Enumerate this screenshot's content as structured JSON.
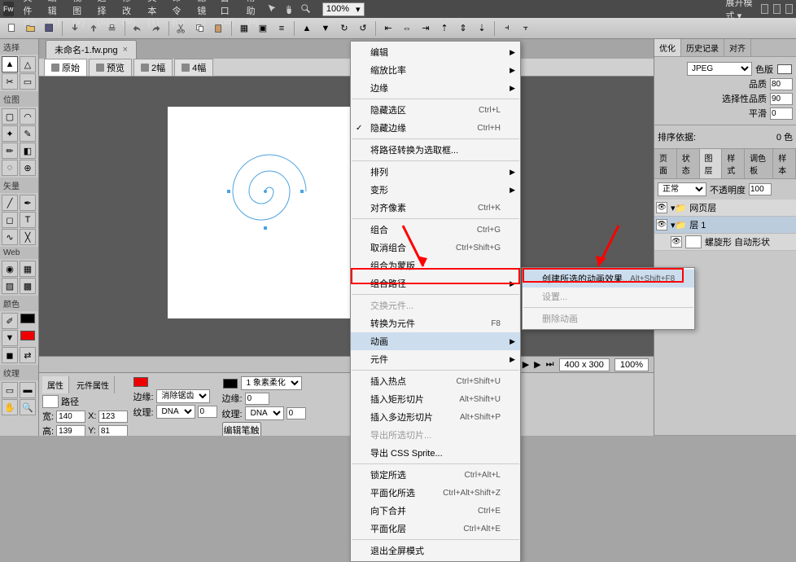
{
  "app": {
    "logo": "Fw"
  },
  "menubar": {
    "items": [
      "文件(F)",
      "编辑(E)",
      "视图(V)",
      "选择(S)",
      "修改(M)",
      "文本(T)",
      "命令(C)",
      "滤镜(I)",
      "窗口(W)",
      "帮助(H)"
    ],
    "zoom": "100%",
    "mode": "展开模式 ▾"
  },
  "left_groups": {
    "g1": "选择",
    "g2": "位图",
    "g3": "矢量",
    "g4": "Web",
    "g5": "颜色",
    "g6": "纹理"
  },
  "doc": {
    "tab": "未命名-1.fw.png",
    "viewtabs": {
      "original": "原始",
      "preview": "预览",
      "two": "2幅",
      "four": "4幅"
    }
  },
  "status": {
    "size": "400 x 300",
    "zoom": "100%"
  },
  "prop": {
    "tabs": {
      "p": "属性",
      "s": "元件属性"
    },
    "path_label": "路径",
    "stroke_label": "边缘:",
    "stroke_val": "消除锯齿",
    "fill_label": "纹理:",
    "fill_val": "DNA",
    "fill_pct": "0",
    "edge_label": "边缘:",
    "edge_val": "0",
    "tex_label": "纹理:",
    "tex_val": "DNA",
    "tex_pct": "0",
    "soft": "1 象素柔化",
    "w_label": "宽:",
    "w": "140",
    "x_label": "X:",
    "x": "123",
    "h_label": "高:",
    "h": "139",
    "y_label": "Y:",
    "y": "81",
    "btn": "编辑笔触"
  },
  "ctx": {
    "items": [
      {
        "t": "编辑",
        "sub": true
      },
      {
        "t": "缩放比率",
        "sub": true
      },
      {
        "t": "边缘",
        "sub": true
      },
      {
        "sep": true
      },
      {
        "t": "隐藏选区",
        "s": "Ctrl+L"
      },
      {
        "t": "隐藏边缘",
        "s": "Ctrl+H",
        "checked": true
      },
      {
        "sep": true
      },
      {
        "t": "将路径转换为选取框..."
      },
      {
        "sep": true
      },
      {
        "t": "排列",
        "sub": true
      },
      {
        "t": "变形",
        "sub": true
      },
      {
        "t": "对齐像素",
        "s": "Ctrl+K"
      },
      {
        "sep": true
      },
      {
        "t": "组合",
        "s": "Ctrl+G"
      },
      {
        "t": "取消组合",
        "s": "Ctrl+Shift+G"
      },
      {
        "t": "组合为蒙版"
      },
      {
        "t": "组合路径",
        "sub": true
      },
      {
        "sep": true
      },
      {
        "t": "交换元件...",
        "dis": true
      },
      {
        "t": "转换为元件",
        "s": "F8"
      },
      {
        "t": "动画",
        "sub": true,
        "hl": true
      },
      {
        "t": "元件",
        "sub": true
      },
      {
        "sep": true
      },
      {
        "t": "插入热点",
        "s": "Ctrl+Shift+U"
      },
      {
        "t": "插入矩形切片",
        "s": "Alt+Shift+U"
      },
      {
        "t": "插入多边形切片",
        "s": "Alt+Shift+P"
      },
      {
        "t": "导出所选切片...",
        "dis": true
      },
      {
        "t": "导出 CSS Sprite..."
      },
      {
        "sep": true
      },
      {
        "t": "锁定所选",
        "s": "Ctrl+Alt+L"
      },
      {
        "t": "平面化所选",
        "s": "Ctrl+Alt+Shift+Z"
      },
      {
        "t": "向下合并",
        "s": "Ctrl+E"
      },
      {
        "t": "平面化层",
        "s": "Ctrl+Alt+E"
      },
      {
        "sep": true
      },
      {
        "t": "退出全屏模式"
      }
    ],
    "sub": [
      {
        "t": "创建所选的动画效果...",
        "s": "Alt+Shift+F8",
        "hl": true
      },
      {
        "t": "设置...",
        "dis": true
      },
      {
        "sep": true
      },
      {
        "t": "删除动画",
        "dis": true
      }
    ]
  },
  "right": {
    "opt_tabs": {
      "o": "优化",
      "h": "历史记录",
      "a": "对齐"
    },
    "format": "JPEG",
    "color_label": "色版",
    "quality_label": "品质",
    "quality": "80",
    "sel_quality_label": "选择性品质",
    "sel_quality": "90",
    "smooth_label": "平滑",
    "smooth": "0",
    "sort_label": "排序依据:",
    "sort_count": "0 色",
    "layer_tabs": {
      "p": "页面",
      "s": "状态",
      "l": "图层",
      "y": "样式",
      "c": "调色板",
      "w": "样本"
    },
    "blend": "正常",
    "opacity_label": "不透明度",
    "opacity": "100",
    "layers": [
      {
        "name": "网页层",
        "folder": true
      },
      {
        "name": "层 1",
        "folder": true,
        "sel": true
      },
      {
        "name": "螺旋形 自动形状"
      }
    ]
  }
}
